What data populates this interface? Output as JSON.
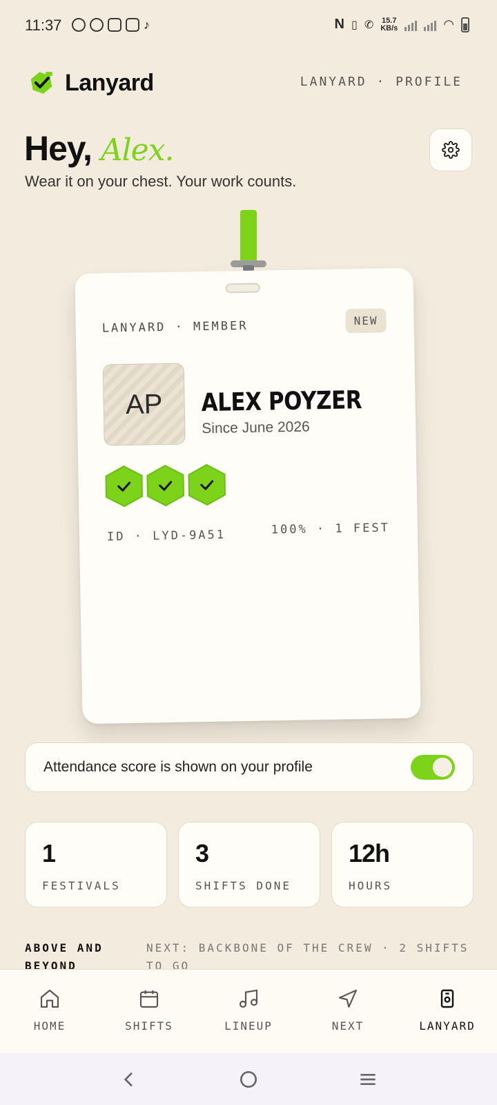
{
  "status_bar": {
    "time": "11:37",
    "net_speed_value": "15.7",
    "net_speed_unit": "KB/s"
  },
  "header": {
    "brand_name": "Lanyard",
    "breadcrumb": "LANYARD · PROFILE"
  },
  "greeting": {
    "hey": "Hey,",
    "name": "Alex.",
    "tagline": "Wear it on your chest. Your work counts."
  },
  "badge": {
    "label": "LANYARD · MEMBER",
    "tag": "NEW",
    "initials": "AP",
    "name": "ALEX POYZER",
    "since": "Since June 2026",
    "hex_badges": 3,
    "id": "ID · LYD-9A51",
    "stats": "100% · 1 FEST"
  },
  "attendance": {
    "text": "Attendance score is shown on your profile",
    "enabled": true
  },
  "stats": [
    {
      "value": "1",
      "label": "FESTIVALS"
    },
    {
      "value": "3",
      "label": "SHIFTS DONE"
    },
    {
      "value": "12h",
      "label": "HOURS"
    }
  ],
  "progress": {
    "title": "ABOVE AND BEYOND",
    "next": "NEXT: BACKBONE OF THE CREW · 2 SHIFTS TO GO"
  },
  "nav": {
    "items": [
      {
        "label": "HOME",
        "icon": "home-icon"
      },
      {
        "label": "SHIFTS",
        "icon": "calendar-icon"
      },
      {
        "label": "LINEUP",
        "icon": "music-note-icon"
      },
      {
        "label": "NEXT",
        "icon": "navigation-arrow-icon"
      },
      {
        "label": "LANYARD",
        "icon": "badge-icon"
      }
    ],
    "active": "LANYARD"
  },
  "colors": {
    "accent": "#7cd31a",
    "background": "#f3ebdd",
    "card": "#fefdf8"
  }
}
